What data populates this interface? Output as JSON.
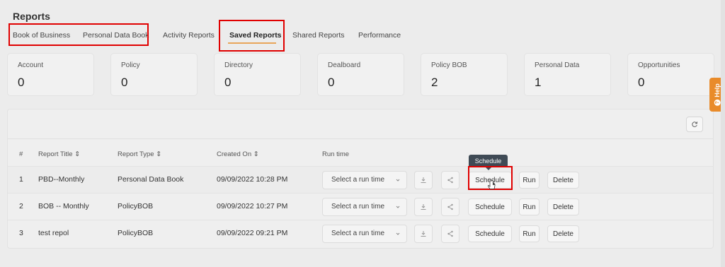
{
  "page": {
    "title": "Reports"
  },
  "tabs": [
    {
      "label": "Book of Business"
    },
    {
      "label": "Personal Data Book"
    },
    {
      "label": "Activity Reports"
    },
    {
      "label": "Saved Reports"
    },
    {
      "label": "Shared Reports"
    },
    {
      "label": "Performance"
    }
  ],
  "active_tab": "Saved Reports",
  "cards": [
    {
      "label": "Account",
      "value": "0"
    },
    {
      "label": "Policy",
      "value": "0"
    },
    {
      "label": "Directory",
      "value": "0"
    },
    {
      "label": "Dealboard",
      "value": "0"
    },
    {
      "label": "Policy BOB",
      "value": "2"
    },
    {
      "label": "Personal Data",
      "value": "1"
    },
    {
      "label": "Opportunities",
      "value": "0"
    }
  ],
  "table": {
    "headers": {
      "num": "#",
      "title": "Report Title ⇕",
      "type": "Report Type ⇕",
      "created": "Created On ⇕",
      "runtime": "Run time"
    },
    "rows": [
      {
        "num": "1",
        "title": "PBD--Monthly",
        "type": "Personal Data Book",
        "created": "09/09/2022 10:28 PM",
        "runtime": "Select a run time"
      },
      {
        "num": "2",
        "title": "BOB -- Monthly",
        "type": "PolicyBOB",
        "created": "09/09/2022 10:27 PM",
        "runtime": "Select a run time"
      },
      {
        "num": "3",
        "title": "test repol",
        "type": "PolicyBOB",
        "created": "09/09/2022 09:21 PM",
        "runtime": "Select a run time"
      }
    ],
    "actions": {
      "schedule": "Schedule",
      "run": "Run",
      "delete": "Delete"
    }
  },
  "tooltip": {
    "text": "Schedule"
  },
  "help": {
    "label": "Help"
  },
  "colors": {
    "accent": "#e8a65a",
    "highlight": "#e00000",
    "help": "#e98b2a",
    "tooltip": "#3f4a55"
  },
  "icons": [
    "refresh-icon",
    "download-icon",
    "share-icon",
    "chevron-down-icon",
    "help-icon",
    "pointer-cursor-icon"
  ]
}
